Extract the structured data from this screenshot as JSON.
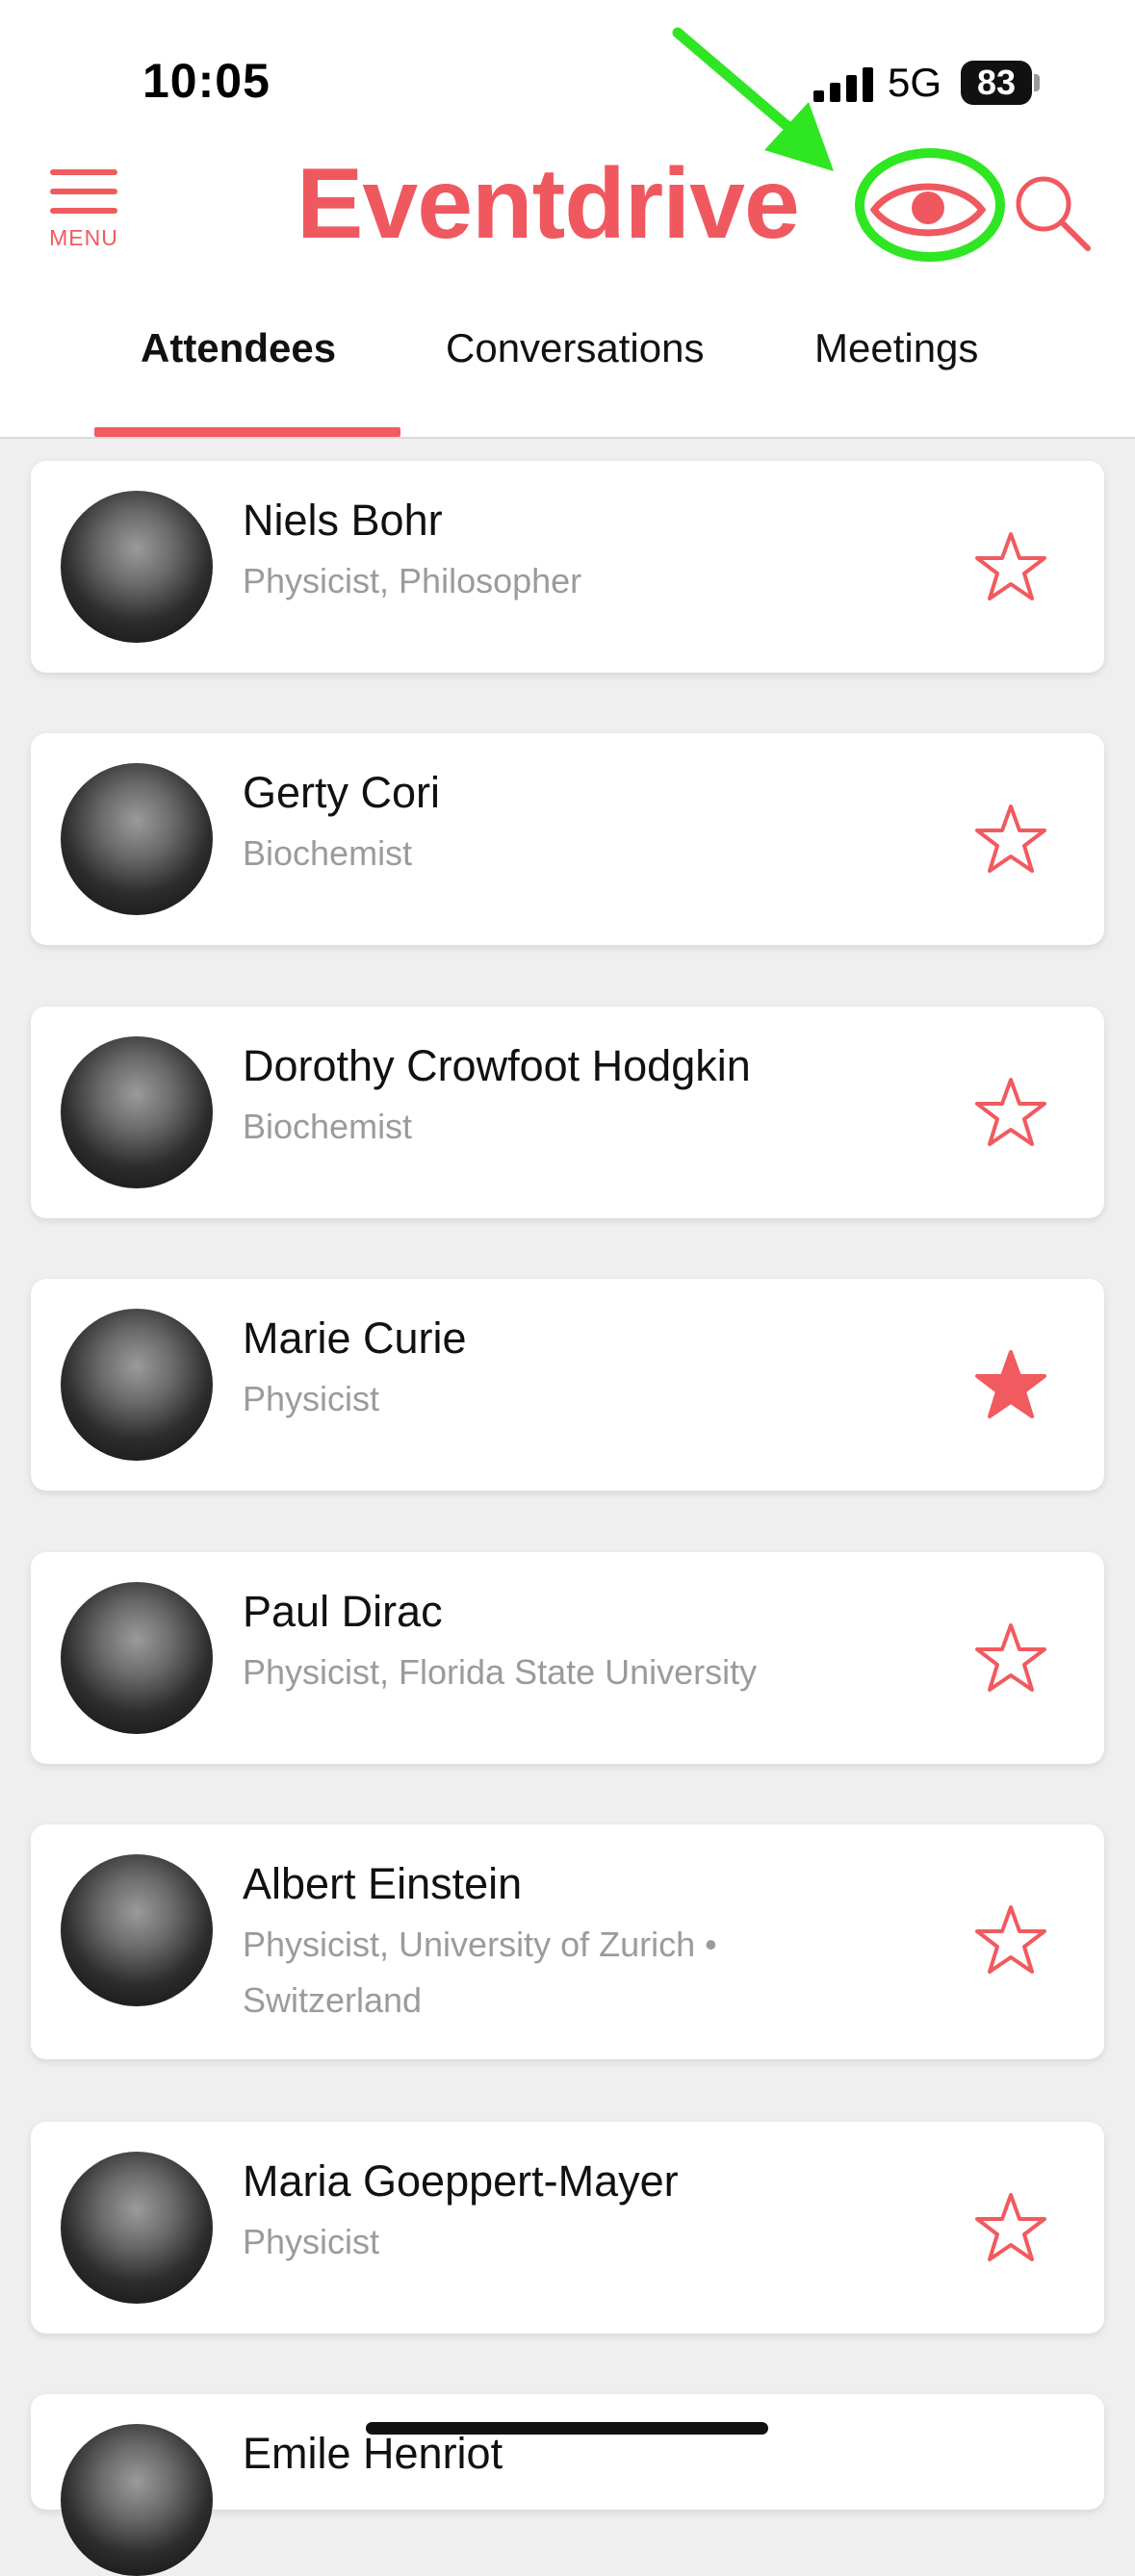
{
  "status_bar": {
    "time": "10:05",
    "network": "5G",
    "battery": "83"
  },
  "header": {
    "menu_label": "MENU",
    "brand": "Eventdrive"
  },
  "tabs": [
    {
      "label": "Attendees",
      "active": true
    },
    {
      "label": "Conversations",
      "active": false
    },
    {
      "label": "Meetings",
      "active": false
    }
  ],
  "attendees": [
    {
      "name": "Niels Bohr",
      "subtitle": "Physicist, Philosopher",
      "favorite": false
    },
    {
      "name": "Gerty Cori",
      "subtitle": "Biochemist",
      "favorite": false
    },
    {
      "name": "Dorothy Crowfoot Hodgkin",
      "subtitle": "Biochemist",
      "favorite": false
    },
    {
      "name": "Marie Curie",
      "subtitle": "Physicist",
      "favorite": true
    },
    {
      "name": "Paul Dirac",
      "subtitle": "Physicist, Florida State University",
      "favorite": false
    },
    {
      "name": "Albert Einstein",
      "subtitle": "Physicist, University of Zurich • Switzerland",
      "favorite": false
    },
    {
      "name": "Maria Goeppert-Mayer",
      "subtitle": "Physicist",
      "favorite": false
    },
    {
      "name": "Emile Henriot",
      "subtitle": "",
      "favorite": false
    }
  ],
  "colors": {
    "accent": "#f15a5f",
    "highlight": "#2ee621",
    "background": "#efefef"
  },
  "icons": [
    "menu-icon",
    "eye-icon",
    "search-icon",
    "star-icon",
    "star-filled-icon"
  ]
}
